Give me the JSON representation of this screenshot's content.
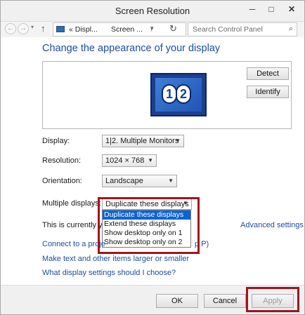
{
  "window": {
    "title": "Screen Resolution",
    "minimize": "─",
    "maximize": "□",
    "close": "✕"
  },
  "nav": {
    "back_icon": "←",
    "forward_icon": "→",
    "recent_icon": "▾",
    "up_icon": "↑",
    "crumb_1": "« Displ...",
    "crumb_2": "Screen ...",
    "address_dropdown_icon": "▾",
    "refresh_icon": "↻",
    "search_placeholder": "Search Control Panel",
    "search_icon": "⌕"
  },
  "main": {
    "heading": "Change the appearance of your display",
    "monitor_badge_1": "1",
    "monitor_badge_2": "2",
    "detect_label": "Detect",
    "identify_label": "Identify"
  },
  "settings": {
    "display_label": "Display:",
    "display_value": "1|2. Multiple Monitors",
    "resolution_label": "Resolution:",
    "resolution_value": "1024 × 768",
    "orientation_label": "Orientation:",
    "orientation_value": "Landscape",
    "multiple_label": "Multiple displays:",
    "multiple_value": "Duplicate these displays",
    "combo_arrow": "▼"
  },
  "dropdown": {
    "options": [
      "Duplicate these displays",
      "Extend these displays",
      "Show desktop only on 1",
      "Show desktop only on 2"
    ],
    "selected_index": 0
  },
  "status": {
    "currently_text": "This is currently yo",
    "advanced_link": "Advanced settings"
  },
  "links": {
    "connect_projector": "Connect to a proje",
    "connect_projector_tail": "p P)",
    "text_size": "Make text and other items larger or smaller",
    "which_settings": "What display settings should I choose?"
  },
  "footer": {
    "ok_label": "OK",
    "cancel_label": "Cancel",
    "apply_label": "Apply"
  },
  "colors": {
    "link": "#1c4c9e",
    "highlight": "#a2141e",
    "selection": "#0a64d6"
  }
}
